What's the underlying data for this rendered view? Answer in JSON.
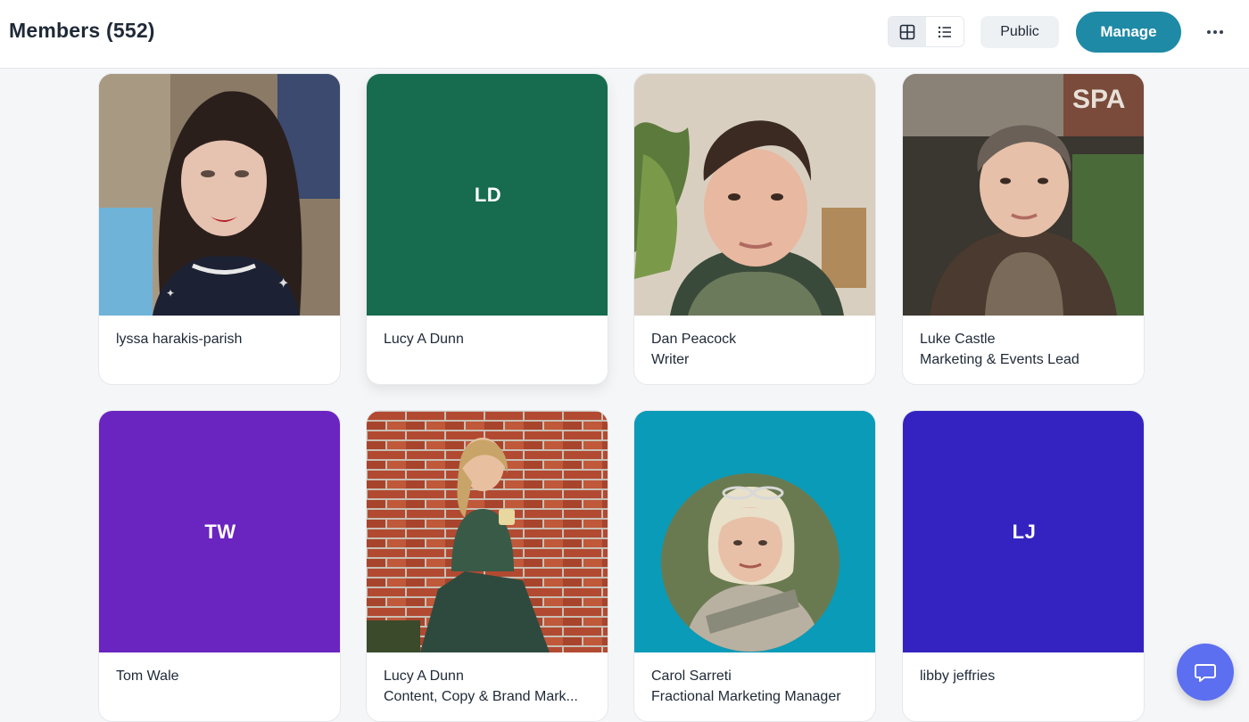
{
  "header": {
    "title": "Members (552)",
    "public_label": "Public",
    "manage_label": "Manage",
    "view_modes": [
      "grid-icon",
      "list-icon"
    ],
    "active_view": "grid"
  },
  "members": [
    {
      "name": "lyssa harakis-parish",
      "role": "",
      "avatar": "photo"
    },
    {
      "name": "Lucy A Dunn",
      "role": "",
      "avatar": "initials",
      "initials": "LD",
      "color": "#176b4f"
    },
    {
      "name": "Dan Peacock",
      "role": "Writer",
      "avatar": "photo"
    },
    {
      "name": "Luke Castle",
      "role": "Marketing & Events Lead",
      "avatar": "photo"
    },
    {
      "name": "Tom Wale",
      "role": "",
      "avatar": "initials",
      "initials": "TW",
      "color": "#6a24c0"
    },
    {
      "name": "Lucy A Dunn",
      "role": "Content, Copy & Brand Mark...",
      "avatar": "photo"
    },
    {
      "name": "Carol Sarreti",
      "role": "Fractional Marketing Manager",
      "avatar": "photo",
      "color": "#0a9bb8"
    },
    {
      "name": "libby jeffries",
      "role": "",
      "avatar": "initials",
      "initials": "LJ",
      "color": "#3423c0"
    }
  ],
  "colors": {
    "accent": "#1f8aa6",
    "chat_button": "#5b6ff0"
  }
}
